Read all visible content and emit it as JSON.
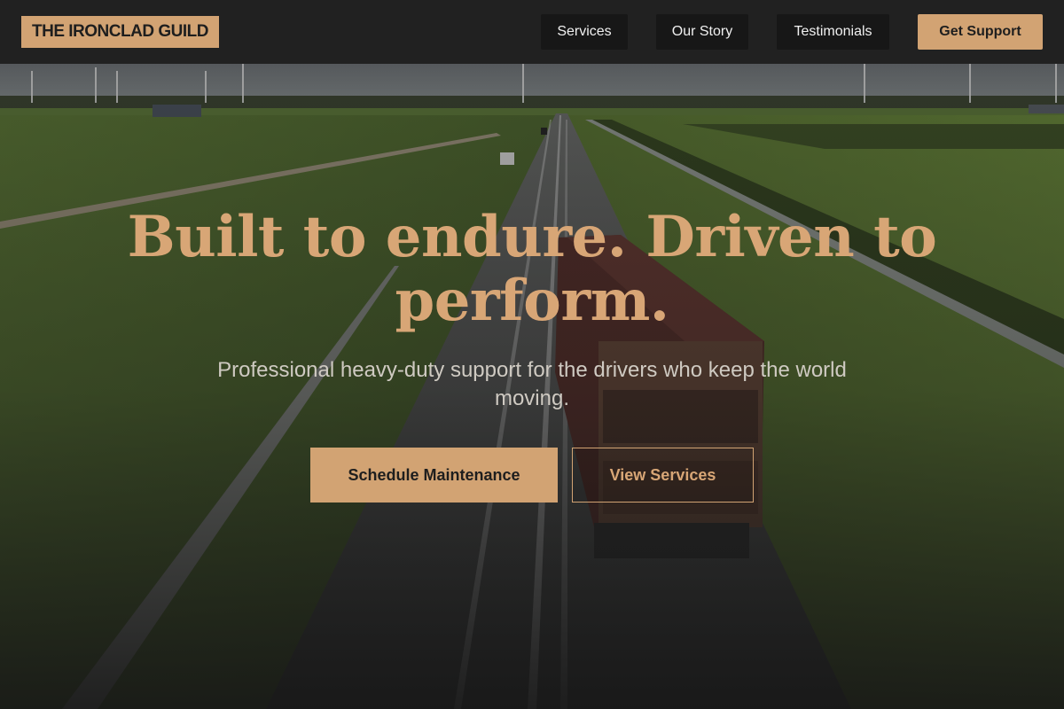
{
  "brand": {
    "name": "THE IRONCLAD GUILD"
  },
  "nav": {
    "items": [
      {
        "label": "Services"
      },
      {
        "label": "Our Story"
      },
      {
        "label": "Testimonials"
      }
    ],
    "cta_label": "Get Support"
  },
  "hero": {
    "headline": "Built to endure. Driven to perform.",
    "subheadline": "Professional heavy-duty support for the drivers who keep the world moving.",
    "primary_button": "Schedule Maintenance",
    "secondary_button": "View Services"
  },
  "colors": {
    "accent": "#d2a373",
    "navbar": "#212121",
    "nav_button": "#171717"
  }
}
